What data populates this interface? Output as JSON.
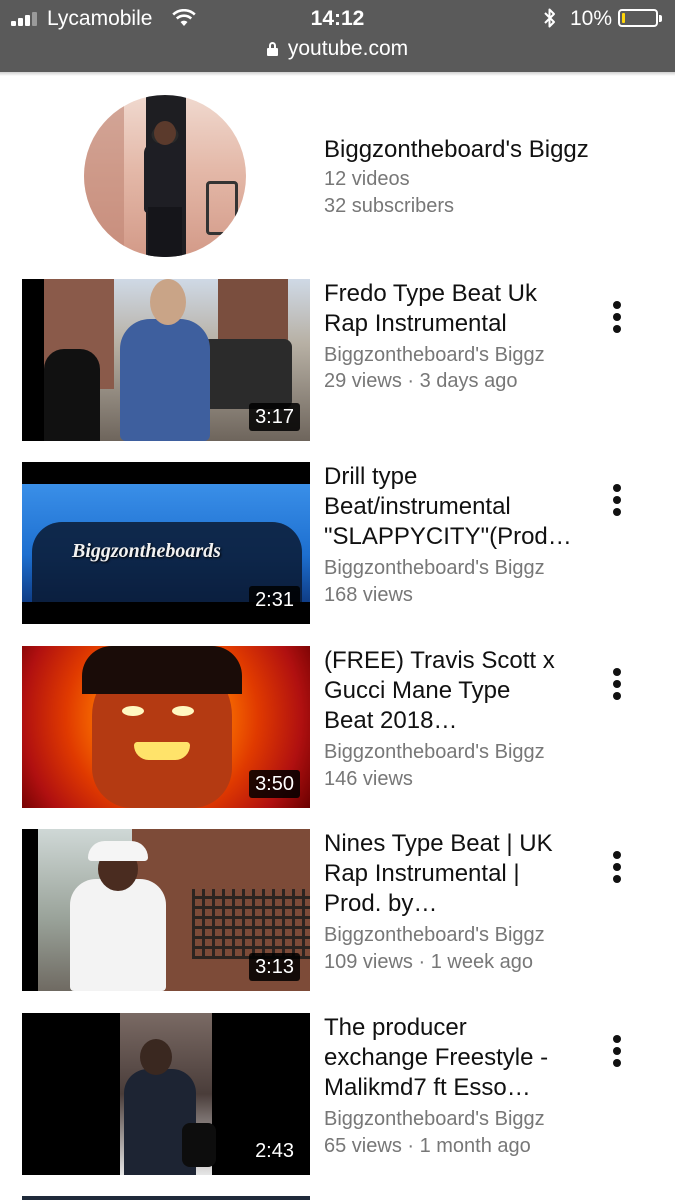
{
  "status_bar": {
    "carrier": "Lycamobile",
    "time": "14:12",
    "battery_percent": "10%",
    "battery_level": 0.1,
    "battery_color": "#ffd60a",
    "icons": [
      "signal-icon",
      "wifi-icon",
      "bluetooth-icon",
      "battery-icon"
    ]
  },
  "browser": {
    "url": "youtube.com",
    "bar_color": "#5a5a5a"
  },
  "channel": {
    "name": "Biggzontheboard's Biggz",
    "videos": "12 videos",
    "subscribers": "32 subscribers"
  },
  "videos": [
    {
      "title_lines": [
        "Fredo Type Beat Uk",
        "Rap Instrumental"
      ],
      "channel": "Biggzontheboard's Biggz",
      "meta": "29 views · 3 days ago",
      "duration": "3:17"
    },
    {
      "title_lines": [
        "Drill type",
        "Beat/instrumental",
        "\"SLAPPYCITY\"(Prod…"
      ],
      "channel": "Biggzontheboard's Biggz",
      "meta": "168 views",
      "duration": "2:31",
      "thumb_text": "Biggzontheboards"
    },
    {
      "title_lines": [
        "(FREE) Travis Scott x",
        "Gucci Mane Type",
        "Beat 2018…"
      ],
      "channel": "Biggzontheboard's Biggz",
      "meta": "146 views",
      "duration": "3:50"
    },
    {
      "title_lines": [
        "Nines Type Beat | UK",
        "Rap Instrumental |",
        "Prod. by…"
      ],
      "channel": "Biggzontheboard's Biggz",
      "meta": "109 views · 1 week ago",
      "duration": "3:13"
    },
    {
      "title_lines": [
        "The producer",
        "exchange Freestyle -",
        "Malikmd7 ft Esso…"
      ],
      "channel": "Biggzontheboard's Biggz",
      "meta": "65 views · 1 month ago",
      "duration": "2:43"
    }
  ]
}
